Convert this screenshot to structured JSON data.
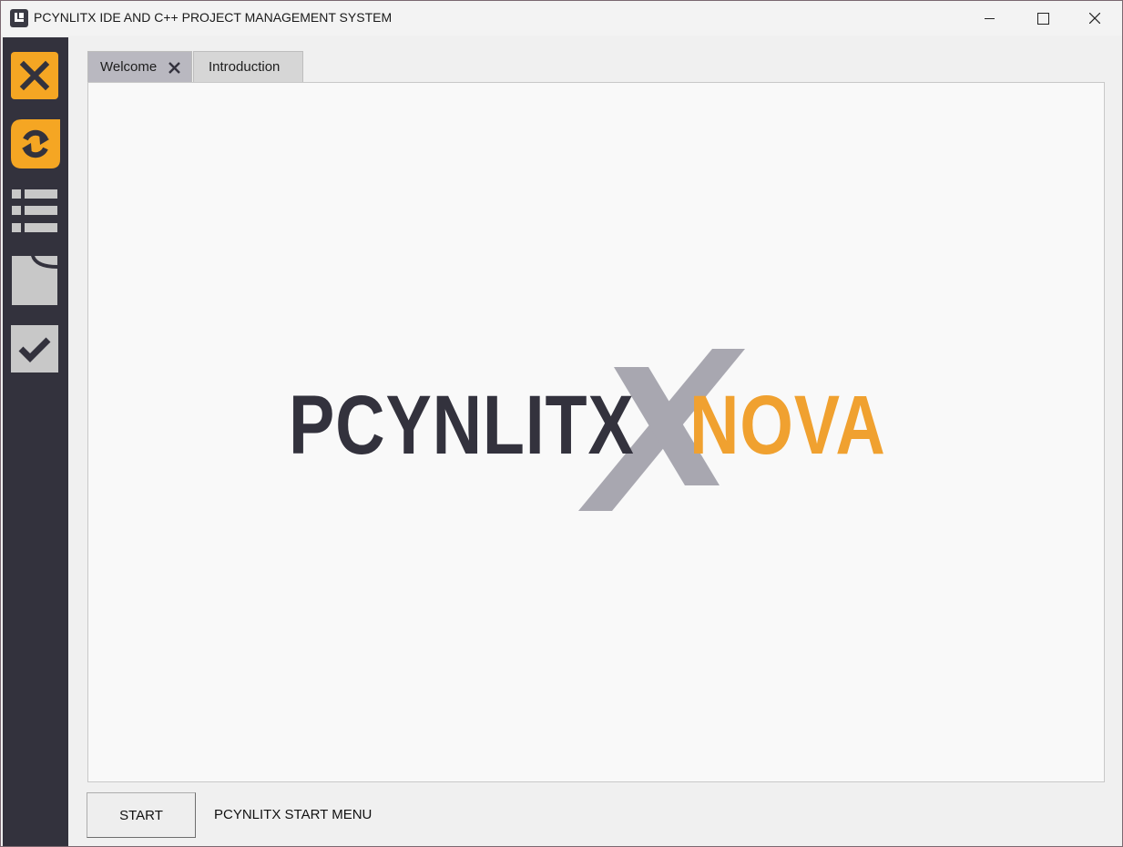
{
  "window": {
    "title": "PCYNLITX IDE AND C++ PROJECT MANAGEMENT SYSTEM",
    "controls": [
      "minimize",
      "maximize",
      "close"
    ]
  },
  "sidebar": {
    "buttons": [
      {
        "icon": "close-icon",
        "color": "#f5a623"
      },
      {
        "icon": "refresh-icon",
        "color": "#f5a623"
      },
      {
        "icon": "list-icon",
        "color": "#c8c8c8"
      },
      {
        "icon": "document-icon",
        "color": "#c8c8c8"
      },
      {
        "icon": "checkmark-icon",
        "color": "#c8c8c8"
      }
    ],
    "background": "#33323d"
  },
  "tabs": [
    {
      "label": "Welcome",
      "active": true,
      "closable": true
    },
    {
      "label": "Introduction",
      "active": false,
      "closable": false
    }
  ],
  "logo": {
    "left_text": "PCYNLITX",
    "right_text": "NOVA",
    "left_color": "#33323d",
    "right_color": "#f0a130",
    "x_color": "#a8a7b0"
  },
  "footer": {
    "start_button": "START",
    "start_label": "PCYNLITX START MENU"
  }
}
